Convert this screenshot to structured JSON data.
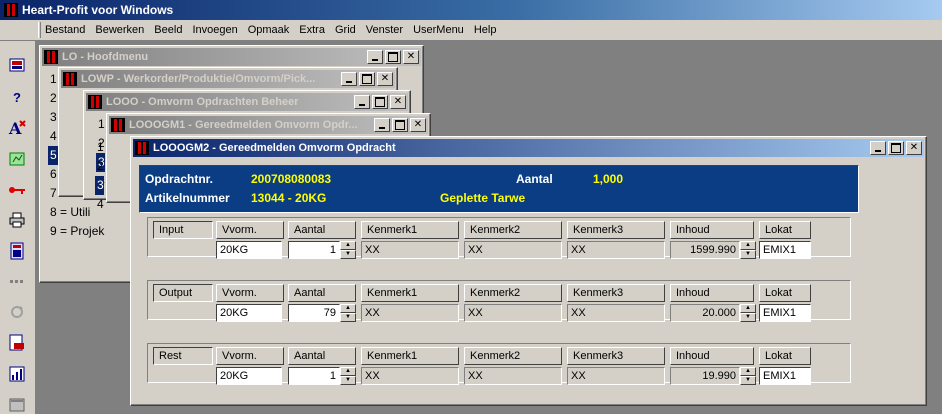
{
  "app": {
    "title": "Heart-Profit voor Windows"
  },
  "menubar": [
    "Bestand",
    "Bewerken",
    "Beeld",
    "Invoegen",
    "Opmaak",
    "Extra",
    "Grid",
    "Venster",
    "UserMenu",
    "Help"
  ],
  "sidebar": {
    "icons": [
      "screen-icon",
      "help-icon",
      "font-color-icon",
      "chart-icon",
      "key-icon",
      "printer-icon",
      "calculator-icon",
      "dots-icon",
      "refresh-icon",
      "document-icon",
      "bar-chart-icon"
    ]
  },
  "windows": {
    "lo": {
      "title": "LO - Hoofdmenu",
      "items": [
        "1",
        "2",
        "3",
        "4",
        "5",
        "6 = Rapp",
        "7 = Rapp",
        "8 = Utili",
        "9 = Projek"
      ]
    },
    "lowp": {
      "title": "LOWP - Werkorder/Produktie/Omvorm/Pick..."
    },
    "looo": {
      "title": "LOOO - Omvorm Opdrachten Beheer",
      "items": [
        "1",
        "2",
        "3",
        "4"
      ]
    },
    "loogm1": {
      "title": "LOOOGM1 - Gereedmelden Omvorm Opdr...",
      "items": [
        "1",
        "2",
        "3",
        "4"
      ]
    },
    "loogm2": {
      "title": "LOOOGM2 - Gereedmelden Omvorm Opdracht"
    }
  },
  "info": {
    "opdracht_label": "Opdrachtnr.",
    "opdracht_value": "200708080083",
    "aantal_label": "Aantal",
    "aantal_value": "1,000",
    "artikel_label": "Artikelnummer",
    "artikel_value": "13044 - 20KG",
    "artikel_desc": "Geplette Tarwe"
  },
  "columns": [
    "Vvorm.",
    "Aantal",
    "Kenmerk1",
    "Kenmerk2",
    "Kenmerk3",
    "Inhoud",
    "Lokat"
  ],
  "sections": [
    {
      "name": "Input",
      "vvorm": "20KG",
      "aantal": "1",
      "kenmerk1": "XX",
      "kenmerk2": "XX",
      "kenmerk3": "XX",
      "inhoud": "1599.990",
      "lokat": "EMIX1"
    },
    {
      "name": "Output",
      "vvorm": "20KG",
      "aantal": "79",
      "kenmerk1": "XX",
      "kenmerk2": "XX",
      "kenmerk3": "XX",
      "inhoud": "20.000",
      "lokat": "EMIX1"
    },
    {
      "name": "Rest",
      "vvorm": "20KG",
      "aantal": "1",
      "kenmerk1": "XX",
      "kenmerk2": "XX",
      "kenmerk3": "XX",
      "inhoud": "19.990",
      "lokat": "EMIX1"
    }
  ],
  "colors": {
    "title_active": "#0a246a",
    "info_bg": "#0a3d84",
    "info_value": "#ffff00",
    "desktop": "#808080"
  }
}
